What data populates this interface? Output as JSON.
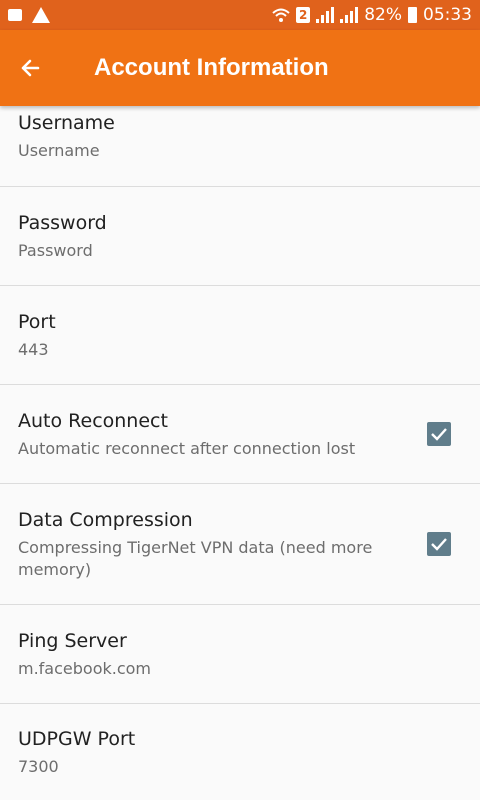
{
  "status_bar": {
    "battery": "82%",
    "time": "05:33",
    "sim_slot": "2",
    "icons": [
      "notification-icon",
      "warning-icon",
      "wifi-icon",
      "signal-icon",
      "battery-icon"
    ]
  },
  "app_bar": {
    "title": "Account Information",
    "back_icon": "arrow-left-icon"
  },
  "settings": [
    {
      "title": "Username",
      "subtitle": "Username",
      "has_checkbox": false
    },
    {
      "title": "Password",
      "subtitle": "Password",
      "has_checkbox": false
    },
    {
      "title": "Port",
      "subtitle": "443",
      "has_checkbox": false
    },
    {
      "title": "Auto Reconnect",
      "subtitle": "Automatic reconnect after connection lost",
      "has_checkbox": true,
      "checked": true
    },
    {
      "title": "Data Compression",
      "subtitle": "Compressing TigerNet VPN data (need more memory)",
      "has_checkbox": true,
      "checked": true
    },
    {
      "title": "Ping Server",
      "subtitle": "m.facebook.com",
      "has_checkbox": false
    },
    {
      "title": "UDPGW Port",
      "subtitle": "7300",
      "has_checkbox": false
    }
  ],
  "colors": {
    "status_bar": "#e0621c",
    "app_bar": "#f07214",
    "checkbox": "#607d8b"
  }
}
